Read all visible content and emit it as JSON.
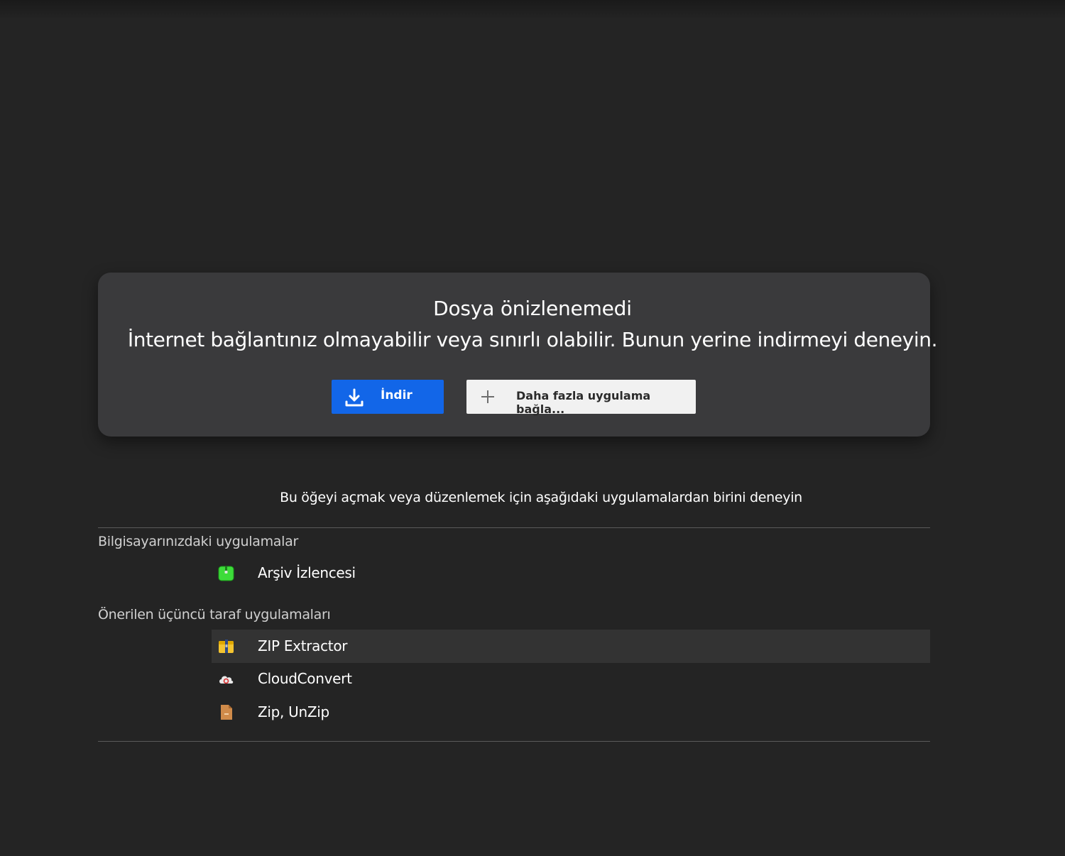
{
  "preview": {
    "title": "Dosya önizlenemedi",
    "subtitle": "İnternet bağlantınız olmayabilir veya sınırlı olabilir. Bunun yerine indirmeyi deneyin.",
    "download_label": "İndir",
    "connect_label": "Daha fazla uygulama bağla...",
    "download_icon": "download-icon",
    "connect_icon": "plus-icon",
    "accent_color": "#1266e8"
  },
  "apps": {
    "hint": "Bu öğeyi açmak veya düzenlemek için aşağıdaki uygulamalardan birini deneyin",
    "computer_section": {
      "label": "Bilgisayarınızdaki uygulamalar",
      "items": [
        {
          "name": "Arşiv İzlencesi",
          "icon": "archive-utility-icon"
        }
      ]
    },
    "third_party_section": {
      "label": "Önerilen üçüncü taraf uygulamaları",
      "items": [
        {
          "name": "ZIP Extractor",
          "icon": "zip-extractor-icon"
        },
        {
          "name": "CloudConvert",
          "icon": "cloudconvert-icon"
        },
        {
          "name": "Zip, UnZip",
          "icon": "zip-unzip-icon"
        }
      ]
    }
  }
}
